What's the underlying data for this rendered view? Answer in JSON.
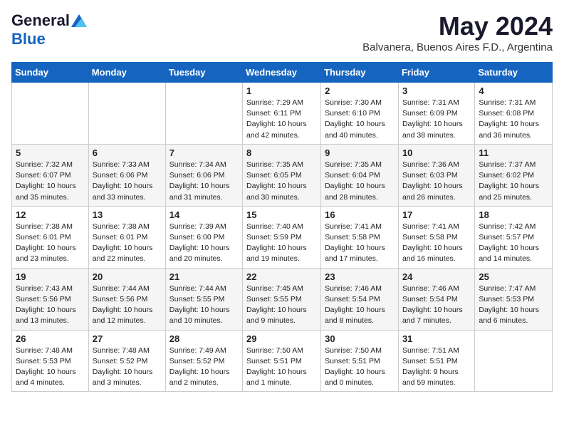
{
  "logo": {
    "general": "General",
    "blue": "Blue"
  },
  "title": "May 2024",
  "subtitle": "Balvanera, Buenos Aires F.D., Argentina",
  "days_of_week": [
    "Sunday",
    "Monday",
    "Tuesday",
    "Wednesday",
    "Thursday",
    "Friday",
    "Saturday"
  ],
  "weeks": [
    [
      {
        "day": "",
        "info": ""
      },
      {
        "day": "",
        "info": ""
      },
      {
        "day": "",
        "info": ""
      },
      {
        "day": "1",
        "info": "Sunrise: 7:29 AM\nSunset: 6:11 PM\nDaylight: 10 hours\nand 42 minutes."
      },
      {
        "day": "2",
        "info": "Sunrise: 7:30 AM\nSunset: 6:10 PM\nDaylight: 10 hours\nand 40 minutes."
      },
      {
        "day": "3",
        "info": "Sunrise: 7:31 AM\nSunset: 6:09 PM\nDaylight: 10 hours\nand 38 minutes."
      },
      {
        "day": "4",
        "info": "Sunrise: 7:31 AM\nSunset: 6:08 PM\nDaylight: 10 hours\nand 36 minutes."
      }
    ],
    [
      {
        "day": "5",
        "info": "Sunrise: 7:32 AM\nSunset: 6:07 PM\nDaylight: 10 hours\nand 35 minutes."
      },
      {
        "day": "6",
        "info": "Sunrise: 7:33 AM\nSunset: 6:06 PM\nDaylight: 10 hours\nand 33 minutes."
      },
      {
        "day": "7",
        "info": "Sunrise: 7:34 AM\nSunset: 6:06 PM\nDaylight: 10 hours\nand 31 minutes."
      },
      {
        "day": "8",
        "info": "Sunrise: 7:35 AM\nSunset: 6:05 PM\nDaylight: 10 hours\nand 30 minutes."
      },
      {
        "day": "9",
        "info": "Sunrise: 7:35 AM\nSunset: 6:04 PM\nDaylight: 10 hours\nand 28 minutes."
      },
      {
        "day": "10",
        "info": "Sunrise: 7:36 AM\nSunset: 6:03 PM\nDaylight: 10 hours\nand 26 minutes."
      },
      {
        "day": "11",
        "info": "Sunrise: 7:37 AM\nSunset: 6:02 PM\nDaylight: 10 hours\nand 25 minutes."
      }
    ],
    [
      {
        "day": "12",
        "info": "Sunrise: 7:38 AM\nSunset: 6:01 PM\nDaylight: 10 hours\nand 23 minutes."
      },
      {
        "day": "13",
        "info": "Sunrise: 7:38 AM\nSunset: 6:01 PM\nDaylight: 10 hours\nand 22 minutes."
      },
      {
        "day": "14",
        "info": "Sunrise: 7:39 AM\nSunset: 6:00 PM\nDaylight: 10 hours\nand 20 minutes."
      },
      {
        "day": "15",
        "info": "Sunrise: 7:40 AM\nSunset: 5:59 PM\nDaylight: 10 hours\nand 19 minutes."
      },
      {
        "day": "16",
        "info": "Sunrise: 7:41 AM\nSunset: 5:58 PM\nDaylight: 10 hours\nand 17 minutes."
      },
      {
        "day": "17",
        "info": "Sunrise: 7:41 AM\nSunset: 5:58 PM\nDaylight: 10 hours\nand 16 minutes."
      },
      {
        "day": "18",
        "info": "Sunrise: 7:42 AM\nSunset: 5:57 PM\nDaylight: 10 hours\nand 14 minutes."
      }
    ],
    [
      {
        "day": "19",
        "info": "Sunrise: 7:43 AM\nSunset: 5:56 PM\nDaylight: 10 hours\nand 13 minutes."
      },
      {
        "day": "20",
        "info": "Sunrise: 7:44 AM\nSunset: 5:56 PM\nDaylight: 10 hours\nand 12 minutes."
      },
      {
        "day": "21",
        "info": "Sunrise: 7:44 AM\nSunset: 5:55 PM\nDaylight: 10 hours\nand 10 minutes."
      },
      {
        "day": "22",
        "info": "Sunrise: 7:45 AM\nSunset: 5:55 PM\nDaylight: 10 hours\nand 9 minutes."
      },
      {
        "day": "23",
        "info": "Sunrise: 7:46 AM\nSunset: 5:54 PM\nDaylight: 10 hours\nand 8 minutes."
      },
      {
        "day": "24",
        "info": "Sunrise: 7:46 AM\nSunset: 5:54 PM\nDaylight: 10 hours\nand 7 minutes."
      },
      {
        "day": "25",
        "info": "Sunrise: 7:47 AM\nSunset: 5:53 PM\nDaylight: 10 hours\nand 6 minutes."
      }
    ],
    [
      {
        "day": "26",
        "info": "Sunrise: 7:48 AM\nSunset: 5:53 PM\nDaylight: 10 hours\nand 4 minutes."
      },
      {
        "day": "27",
        "info": "Sunrise: 7:48 AM\nSunset: 5:52 PM\nDaylight: 10 hours\nand 3 minutes."
      },
      {
        "day": "28",
        "info": "Sunrise: 7:49 AM\nSunset: 5:52 PM\nDaylight: 10 hours\nand 2 minutes."
      },
      {
        "day": "29",
        "info": "Sunrise: 7:50 AM\nSunset: 5:51 PM\nDaylight: 10 hours\nand 1 minute."
      },
      {
        "day": "30",
        "info": "Sunrise: 7:50 AM\nSunset: 5:51 PM\nDaylight: 10 hours\nand 0 minutes."
      },
      {
        "day": "31",
        "info": "Sunrise: 7:51 AM\nSunset: 5:51 PM\nDaylight: 9 hours\nand 59 minutes."
      },
      {
        "day": "",
        "info": ""
      }
    ]
  ]
}
